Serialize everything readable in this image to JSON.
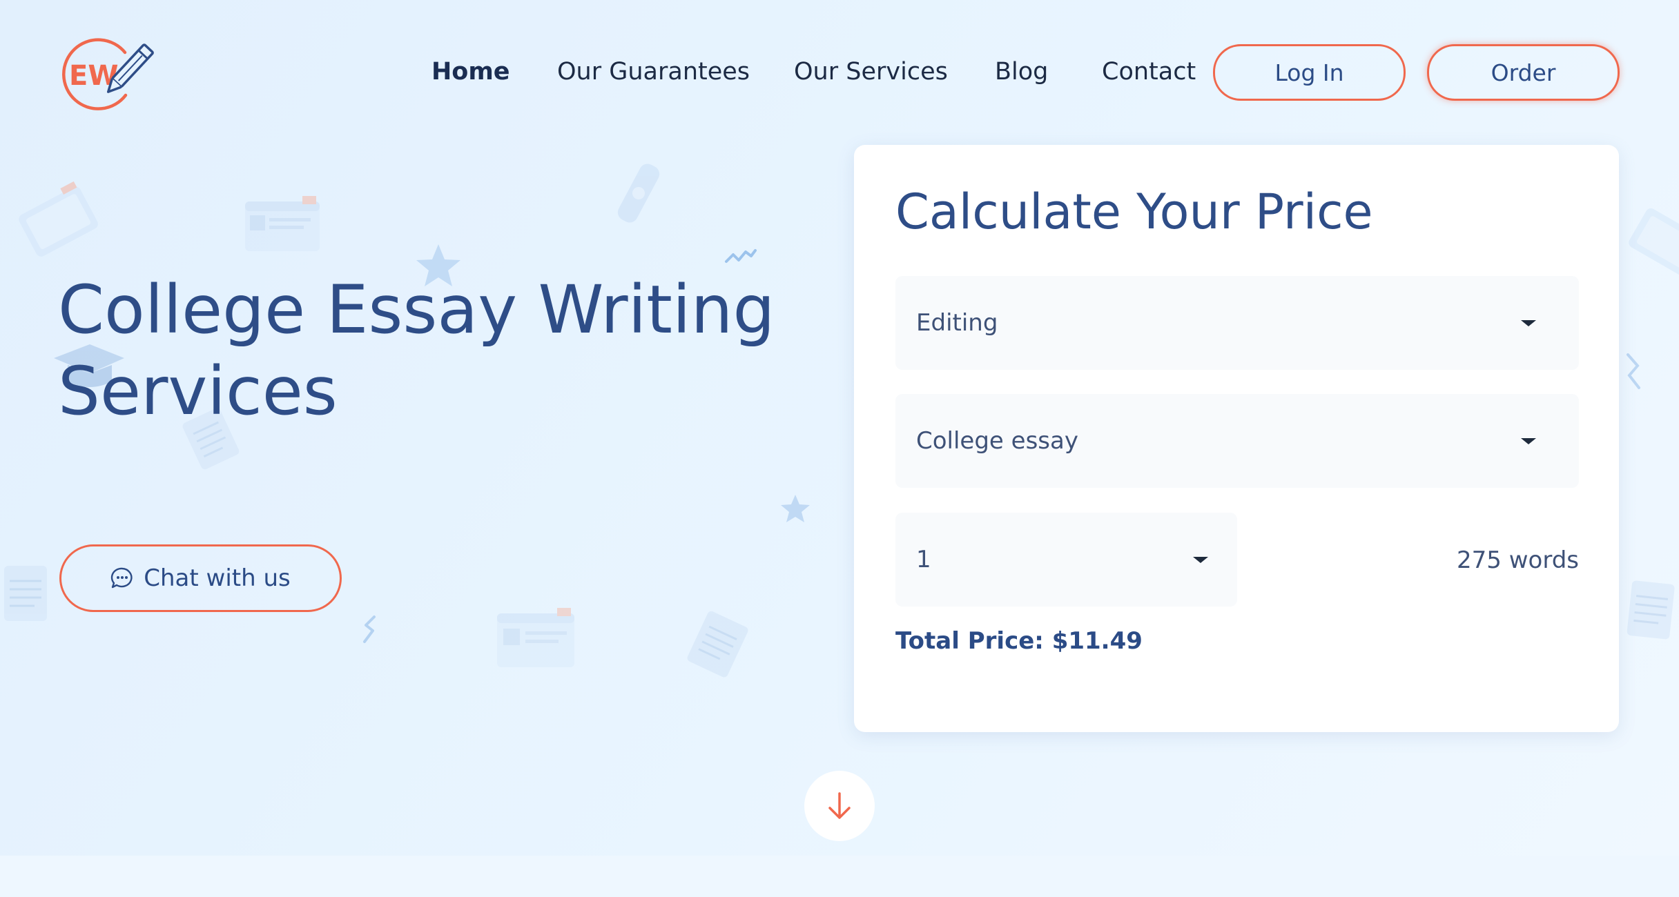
{
  "header": {
    "logo_text": "EW",
    "nav": [
      {
        "label": "Home",
        "active": true
      },
      {
        "label": "Our Guarantees"
      },
      {
        "label": "Our Services"
      },
      {
        "label": "Blog"
      },
      {
        "label": "Contact"
      }
    ],
    "login_label": "Log In",
    "order_label": "Order"
  },
  "hero": {
    "title": "College Essay Writing Services",
    "chat_label": "Chat with us"
  },
  "calculator": {
    "title": "Calculate Your Price",
    "service": "Editing",
    "paper_type": "College essay",
    "pages": "1",
    "words": "275 words",
    "total": "Total Price: $11.49"
  },
  "icons": {
    "chat": "speech-bubble-icon",
    "dropdown": "caret-down-icon",
    "scroll": "arrow-down-icon",
    "logo": "pencil-icon"
  },
  "colors": {
    "accent": "#f0684d",
    "heading": "#2e4d87",
    "nav_text": "#1c2a44",
    "background": "#e6f3fe"
  }
}
